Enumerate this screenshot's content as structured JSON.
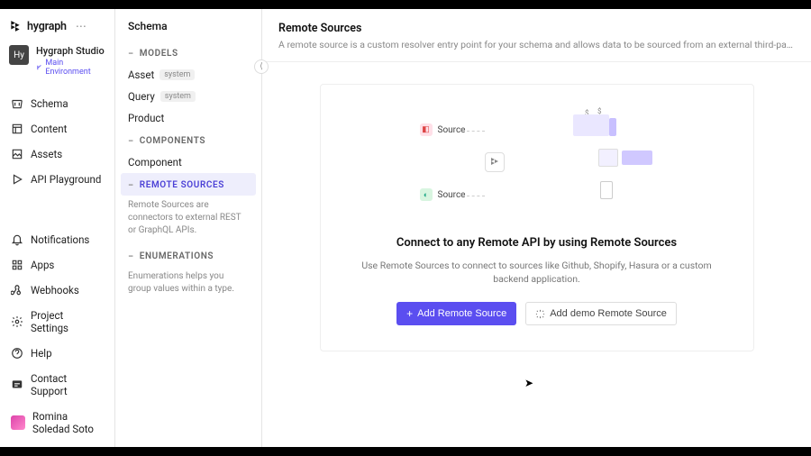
{
  "brand": {
    "name": "hygraph"
  },
  "workspace": {
    "badge": "Hy",
    "name": "Hygraph Studio",
    "env": "Main Environment"
  },
  "nav": {
    "primary": [
      {
        "key": "schema",
        "label": "Schema"
      },
      {
        "key": "content",
        "label": "Content"
      },
      {
        "key": "assets",
        "label": "Assets"
      },
      {
        "key": "api",
        "label": "API Playground"
      }
    ],
    "secondary": [
      {
        "key": "notifications",
        "label": "Notifications"
      },
      {
        "key": "apps",
        "label": "Apps"
      },
      {
        "key": "webhooks",
        "label": "Webhooks"
      },
      {
        "key": "settings",
        "label": "Project Settings"
      },
      {
        "key": "help",
        "label": "Help"
      },
      {
        "key": "support",
        "label": "Contact Support"
      }
    ],
    "user": {
      "name": "Romina Soledad Soto"
    }
  },
  "schema": {
    "title": "Schema",
    "groups": {
      "models": {
        "label": "MODELS",
        "items": [
          {
            "name": "Asset",
            "system": true
          },
          {
            "name": "Query",
            "system": true
          },
          {
            "name": "Product",
            "system": false
          }
        ]
      },
      "components": {
        "label": "COMPONENTS",
        "items": [
          {
            "name": "Component"
          }
        ]
      },
      "remote": {
        "label": "REMOTE SOURCES",
        "help": "Remote Sources are connectors to external REST or GraphQL APIs."
      },
      "enums": {
        "label": "ENUMERATIONS",
        "help": "Enumerations helps you group values within a type."
      }
    },
    "system_pill": "system"
  },
  "main": {
    "title": "Remote Sources",
    "desc": "A remote source is a custom resolver entry point for your schema and allows data to be sourced from an external third-party web service and acc…",
    "empty": {
      "title": "Connect to any Remote API by using Remote Sources",
      "desc": "Use Remote Sources to connect to sources like Github, Shopify, Hasura or a custom backend application.",
      "primary_btn": "Add Remote Source",
      "secondary_btn": "Add demo Remote Source",
      "illus_source_label": "Source"
    }
  }
}
